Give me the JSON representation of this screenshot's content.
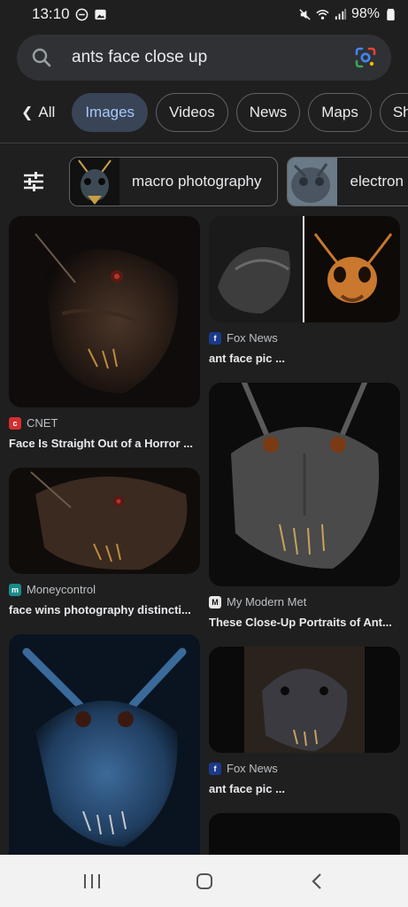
{
  "status": {
    "time": "13:10",
    "battery": "98%"
  },
  "search": {
    "query": "ants face close up"
  },
  "tabs": [
    {
      "label": "All",
      "state": "default"
    },
    {
      "label": "Images",
      "state": "active"
    },
    {
      "label": "Videos",
      "state": "default"
    },
    {
      "label": "News",
      "state": "default"
    },
    {
      "label": "Maps",
      "state": "default"
    },
    {
      "label": "Sho",
      "state": "default"
    }
  ],
  "chips": [
    {
      "label": "macro photography"
    },
    {
      "label": "electron"
    }
  ],
  "results": {
    "left": [
      {
        "source": "CNET",
        "title": "Face Is Straight Out of a Horror ..."
      },
      {
        "source": "Moneycontrol",
        "title": "face wins photography distincti..."
      },
      {
        "source": "",
        "title": ""
      }
    ],
    "right": [
      {
        "source": "Fox News",
        "title": "ant face pic ..."
      },
      {
        "source": "My Modern Met",
        "title": "These Close-Up Portraits of Ant..."
      },
      {
        "source": "Fox News",
        "title": "ant face pic ..."
      }
    ]
  },
  "colors": {
    "background": "#1f1f1f",
    "active_tab_bg": "#394457",
    "active_tab_text": "#a8c7fa"
  }
}
